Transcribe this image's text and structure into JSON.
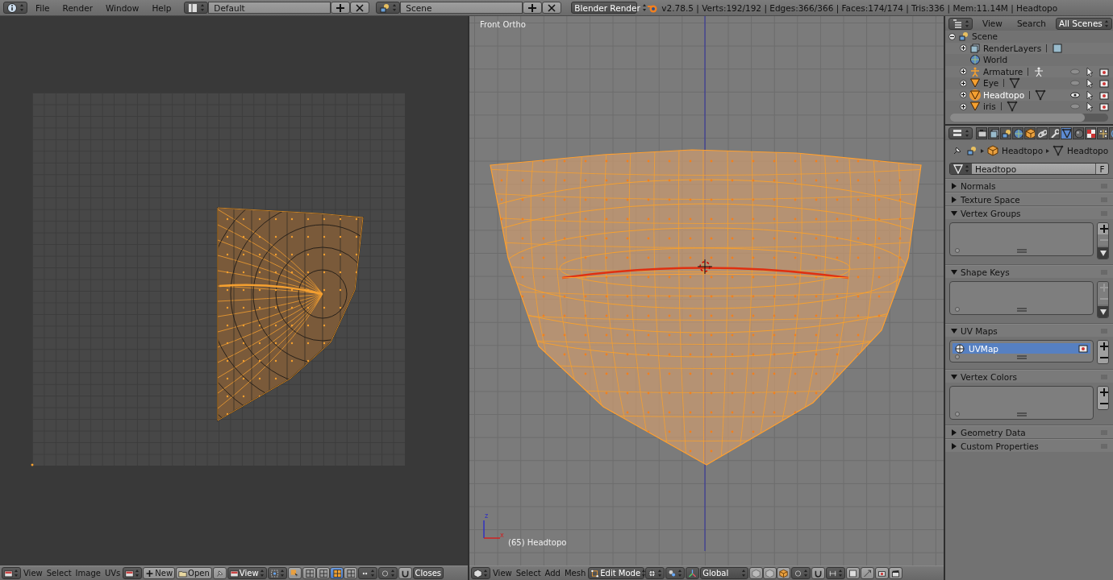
{
  "top_bar": {
    "menus": [
      "File",
      "Render",
      "Window",
      "Help"
    ],
    "screen_layout": "Default",
    "scene": "Scene",
    "render_engine": "Blender Render",
    "stats": "v2.78.5 | Verts:192/192 | Edges:366/366 | Faces:174/174 | Tris:336 | Mem:11.14M | Headtopo"
  },
  "uv_editor": {
    "header": {
      "menus": [
        "View",
        "Select",
        "Image",
        "UVs"
      ],
      "new_label": "New",
      "open_label": "Open",
      "view_label": "View",
      "select_modes": [
        {
          "selected": false
        },
        {
          "selected": false
        },
        {
          "selected": true
        },
        {
          "selected": false
        }
      ],
      "sticky_label": "Closes"
    }
  },
  "viewport": {
    "view_label": "Front Ortho",
    "object_label": "(65) Headtopo",
    "axis_labels": [
      "z",
      "x"
    ],
    "header": {
      "menus": [
        "View",
        "Select",
        "Add",
        "Mesh"
      ],
      "mode": "Edit Mode",
      "orientation": "Global"
    }
  },
  "outliner": {
    "header": {
      "view": "View",
      "search": "Search",
      "filter": "All Scenes"
    },
    "tree": [
      {
        "name": "Scene",
        "kind": "scene",
        "expanded": true,
        "selected": false,
        "children": [
          {
            "name": "RenderLayers",
            "kind": "render_layers",
            "expanded": false,
            "selected": false
          },
          {
            "name": "World",
            "kind": "world",
            "selected": false
          },
          {
            "name": "Armature",
            "kind": "armature",
            "expanded": false,
            "selected": false,
            "hidden": true
          },
          {
            "name": "Eye",
            "kind": "mesh",
            "expanded": false,
            "selected": false,
            "hidden": true
          },
          {
            "name": "Headtopo",
            "kind": "mesh",
            "expanded": false,
            "selected": true,
            "hidden": false
          },
          {
            "name": "iris",
            "kind": "mesh",
            "expanded": false,
            "selected": false,
            "hidden": true
          }
        ]
      }
    ]
  },
  "properties": {
    "tabs": [
      {
        "kind": "render",
        "selected": false
      },
      {
        "kind": "render_layers",
        "selected": false
      },
      {
        "kind": "scene",
        "selected": false
      },
      {
        "kind": "world",
        "selected": false
      },
      {
        "kind": "object",
        "selected": false
      },
      {
        "kind": "constraints",
        "selected": false
      },
      {
        "kind": "modifiers",
        "selected": false
      },
      {
        "kind": "data",
        "selected": true
      },
      {
        "kind": "material",
        "selected": false
      },
      {
        "kind": "texture",
        "selected": false
      },
      {
        "kind": "particles",
        "selected": false
      },
      {
        "kind": "physics",
        "selected": false
      }
    ],
    "breadcrumb": [
      "Headtopo",
      "Headtopo"
    ],
    "datablock": {
      "name": "Headtopo",
      "fake_user": "F"
    },
    "panels": [
      {
        "title": "Normals",
        "kind": "plain",
        "expanded": false
      },
      {
        "title": "Texture Space",
        "kind": "plain",
        "expanded": false
      },
      {
        "title": "Vertex Groups",
        "kind": "list",
        "expanded": true,
        "side_buttons": [
          {
            "kind": "add",
            "disabled": false
          },
          {
            "kind": "remove",
            "disabled": true
          },
          {
            "kind": "specials",
            "disabled": false
          }
        ]
      },
      {
        "title": "Shape Keys",
        "kind": "list",
        "expanded": true,
        "side_buttons": [
          {
            "kind": "add",
            "disabled": true
          },
          {
            "kind": "remove",
            "disabled": true
          },
          {
            "kind": "specials",
            "disabled": false
          }
        ]
      },
      {
        "title": "UV Maps",
        "kind": "list",
        "expanded": true,
        "items": [
          {
            "name": "UVMap",
            "selected": true
          }
        ],
        "side_buttons": [
          {
            "kind": "add",
            "disabled": false
          },
          {
            "kind": "remove",
            "disabled": false
          }
        ]
      },
      {
        "title": "Vertex Colors",
        "kind": "list",
        "expanded": true,
        "side_buttons": [
          {
            "kind": "add",
            "disabled": false
          },
          {
            "kind": "remove",
            "disabled": false
          }
        ]
      },
      {
        "title": "Geometry Data",
        "kind": "plain",
        "expanded": false
      },
      {
        "title": "Custom Properties",
        "kind": "plain",
        "expanded": false
      }
    ]
  }
}
